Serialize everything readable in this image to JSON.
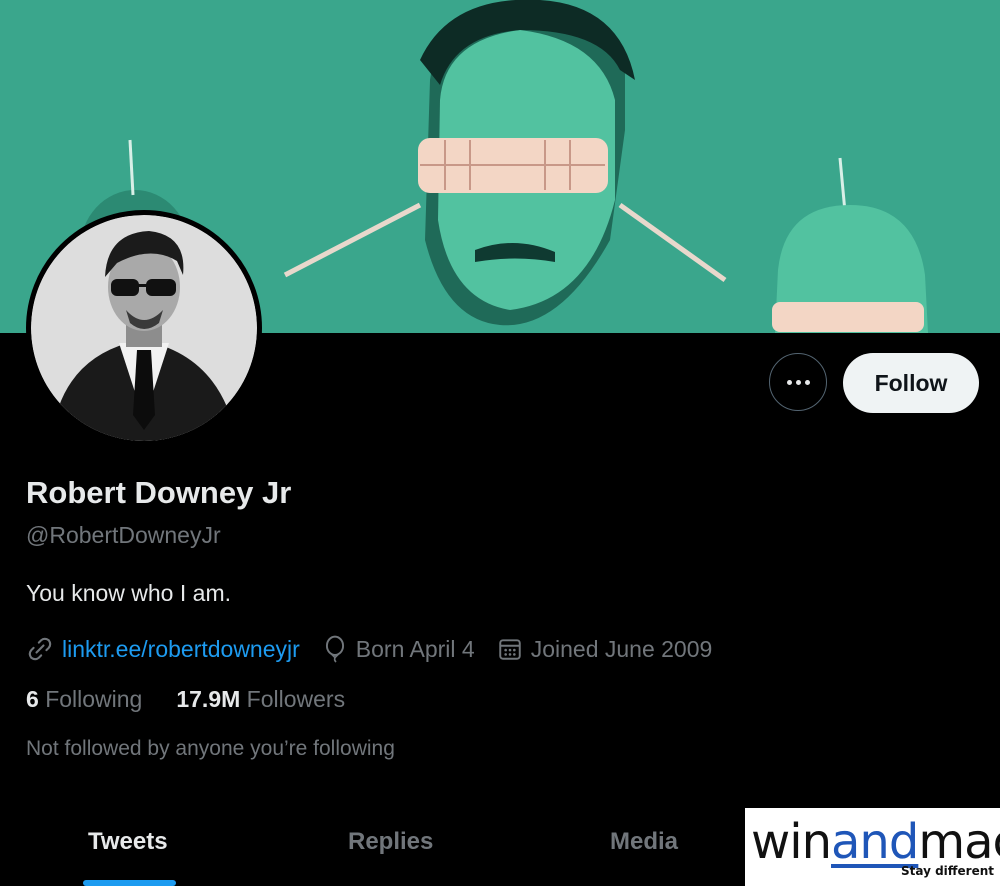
{
  "profile": {
    "name": "Robert Downey Jr",
    "handle": "@RobertDowneyJr",
    "bio": "You know who I am.",
    "link": "linktr.ee/robertdowneyjr",
    "born": "Born April 4",
    "joined": "Joined June 2009",
    "not_followed": "Not followed by anyone you’re following"
  },
  "stats": {
    "following_count": "6",
    "following_label": "Following",
    "followers_count": "17.9M",
    "followers_label": "Followers"
  },
  "actions": {
    "follow_label": "Follow",
    "more_icon": "more-horizontal-icon"
  },
  "tabs": [
    {
      "label": "Tweets",
      "active": true
    },
    {
      "label": "Replies",
      "active": false
    },
    {
      "label": "Media",
      "active": false
    }
  ],
  "watermark": {
    "word_start": "win",
    "word_mid": "and",
    "word_end": "mac",
    "tagline": "Stay different"
  },
  "colors": {
    "background": "#000000",
    "banner": "#3aa68c",
    "accent": "#1d9bf0",
    "muted": "#71767b",
    "follow_button_bg": "#eff3f4"
  }
}
